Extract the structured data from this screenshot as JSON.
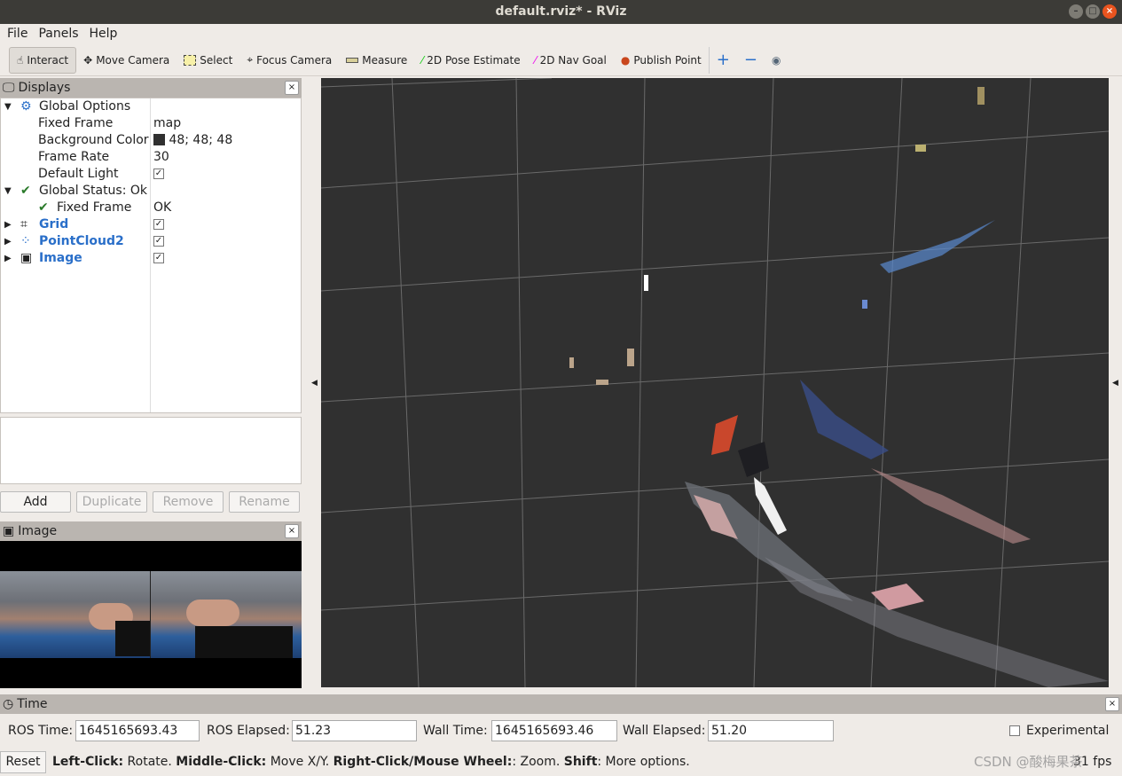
{
  "window": {
    "title": "default.rviz* - RViz"
  },
  "menu": [
    "File",
    "Panels",
    "Help"
  ],
  "toolbar": [
    {
      "label": "Interact",
      "icon": "hand-icon",
      "active": true
    },
    {
      "label": "Move Camera",
      "icon": "move-icon"
    },
    {
      "label": "Select",
      "icon": "select-box-icon"
    },
    {
      "label": "Focus Camera",
      "icon": "crosshair-icon"
    },
    {
      "label": "Measure",
      "icon": "ruler-icon"
    },
    {
      "label": "2D Pose Estimate",
      "icon": "green-arrow-icon"
    },
    {
      "label": "2D Nav Goal",
      "icon": "magenta-arrow-icon"
    },
    {
      "label": "Publish Point",
      "icon": "map-pin-icon"
    }
  ],
  "displays": {
    "title": "Displays",
    "global_options": "Global Options",
    "fixed_frame_label": "Fixed Frame",
    "fixed_frame": "map",
    "bg_label": "Background Color",
    "bg": "48; 48; 48",
    "bg_color": "#303030",
    "rate_label": "Frame Rate",
    "rate": "30",
    "light_label": "Default Light",
    "status": "Global Status: Ok",
    "status_ff_label": "Fixed Frame",
    "status_ff": "OK",
    "grid": "Grid",
    "pc": "PointCloud2",
    "image": "Image"
  },
  "buttons": {
    "add": "Add",
    "duplicate": "Duplicate",
    "remove": "Remove",
    "rename": "Rename"
  },
  "image_panel": {
    "title": "Image"
  },
  "time": {
    "title": "Time",
    "ros_time_label": "ROS Time:",
    "ros_time": "1645165693.43",
    "ros_elapsed_label": "ROS Elapsed:",
    "ros_elapsed": "51.23",
    "wall_time_label": "Wall Time:",
    "wall_time": "1645165693.46",
    "wall_elapsed_label": "Wall Elapsed:",
    "wall_elapsed": "51.20",
    "experimental": "Experimental"
  },
  "status": {
    "reset": "Reset",
    "b1": "Left-Click:",
    "t1": " Rotate. ",
    "b2": "Middle-Click:",
    "t2": " Move X/Y. ",
    "b3": "Right-Click/Mouse Wheel:",
    "t3": ": Zoom. ",
    "b4": "Shift",
    "t4": ": More options.",
    "fps": "31 fps",
    "watermark": "CSDN @酸梅果茶"
  }
}
